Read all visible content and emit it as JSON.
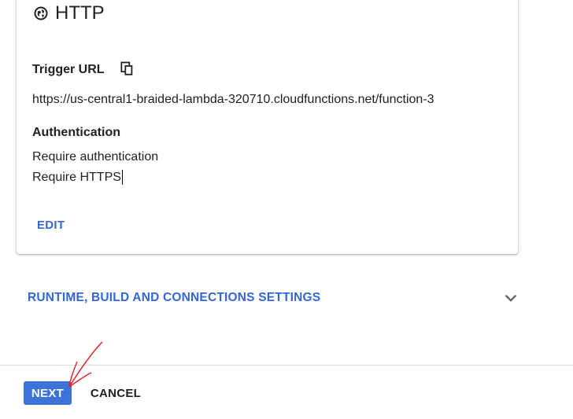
{
  "card": {
    "title": "HTTP",
    "title_icon": "globe-icon",
    "trigger_label": "Trigger URL",
    "copy_icon": "copy-icon",
    "trigger_url": "https://us-central1-braided-lambda-320710.cloudfunctions.net/function-3",
    "auth_label": "Authentication",
    "auth_values": [
      "Require authentication",
      "Require HTTPS"
    ],
    "edit_label": "EDIT"
  },
  "settings": {
    "runtime_label": "RUNTIME, BUILD AND CONNECTIONS SETTINGS",
    "expand_icon": "chevron-down-icon"
  },
  "footer": {
    "next_label": "NEXT",
    "cancel_label": "CANCEL"
  },
  "colors": {
    "accent": "#3367d6",
    "primary_button": "#3b73d9",
    "annotation_arrow": "#e0202a"
  }
}
